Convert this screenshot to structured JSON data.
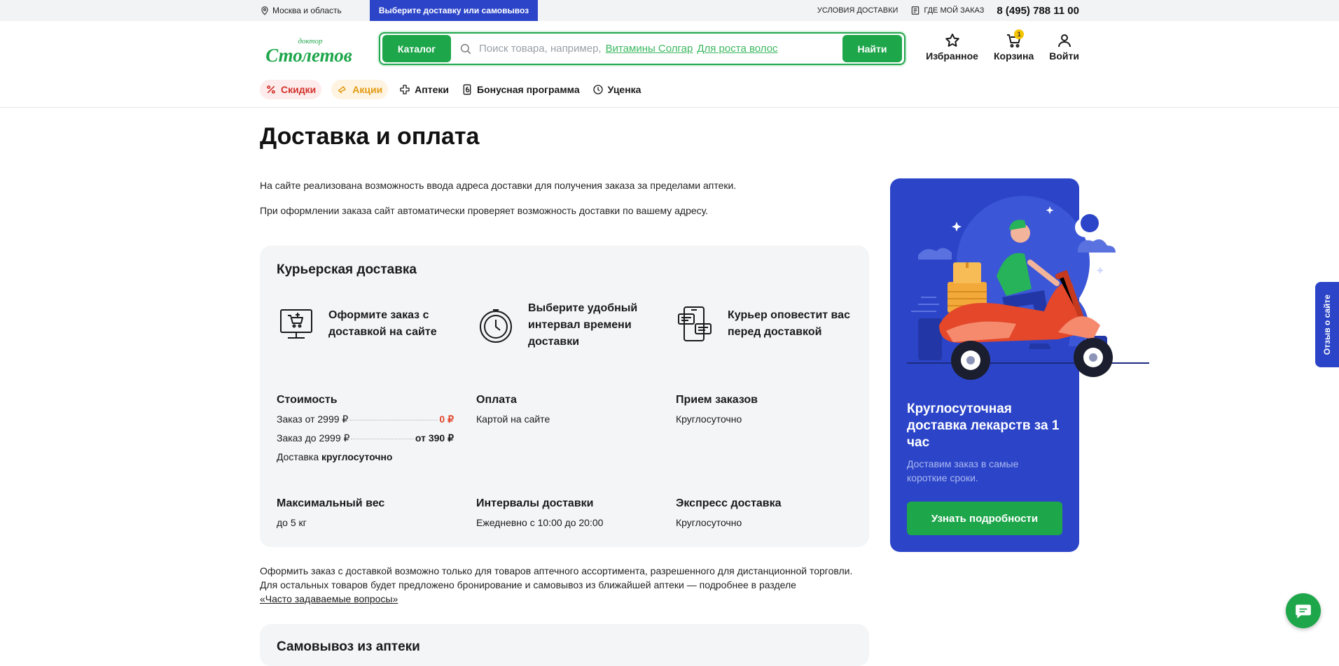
{
  "topbar": {
    "location": "Москва и область",
    "delivery_button": "Выберите доставку или самовывоз",
    "delivery_terms": "условия доставки",
    "where_order": "где мой заказ",
    "phone": "8 (495) 788 11 00"
  },
  "header": {
    "logo_top": "доктор",
    "logo_main": "Столетов",
    "catalog_button": "Каталог",
    "search_placeholder": "Поиск товара, например,",
    "search_example_1": "Витамины Солгар",
    "search_example_2": "Для роста волос",
    "find_button": "Найти",
    "favorites": "Избранное",
    "cart": "Корзина",
    "cart_count": "1",
    "login": "Войти"
  },
  "nav": {
    "sale": "Скидки",
    "promo": "Акции",
    "pharmacies": "Аптеки",
    "bonus": "Бонусная программа",
    "markdown": "Уценка"
  },
  "page": {
    "title": "Доставка и оплата",
    "intro_1": "На сайте реализована возможность ввода адреса доставки для получения заказа за пределами аптеки.",
    "intro_2": "При оформлении заказа сайт автоматически проверяет возможность доставки по вашему адресу."
  },
  "courier": {
    "title": "Курьерская доставка",
    "steps": [
      "Оформите заказ с доставкой на сайте",
      "Выберите удобный интервал времени доставки",
      "Курьер оповестит вас перед доставкой"
    ],
    "cost": {
      "heading": "Стоимость",
      "row1_label": "Заказ от 2999 ₽",
      "row1_value": "0 ₽",
      "row2_label": "Заказ до 2999 ₽",
      "row2_value": "от 390 ₽",
      "row3_label": "Доставка",
      "row3_value": "круглосуточно"
    },
    "payment": {
      "heading": "Оплата",
      "value": "Картой на сайте"
    },
    "orders": {
      "heading": "Прием заказов",
      "value": "Круглосуточно"
    },
    "weight": {
      "heading": "Максимальный вес",
      "value": "до 5 кг"
    },
    "intervals": {
      "heading": "Интервалы доставки",
      "value": "Ежедневно с 10:00 до 20:00"
    },
    "express": {
      "heading": "Экспресс доставка",
      "value": "Круглосуточно"
    }
  },
  "bottom": {
    "text": "Оформить заказ с доставкой возможно только для товаров аптечного ассортимента, разрешенного для дистанционной торговли. Для остальных товаров будет предложено бронирование и самовывоз из ближайшей аптеки — подробнее в разделе",
    "link": "«Часто задаваемые вопросы»",
    "pickup_title": "Самовывоз из аптеки"
  },
  "promo_card": {
    "title": "Круглосуточная доставка лекарств за 1 час",
    "subtitle": "Доставим заказ в самые короткие сроки.",
    "button": "Узнать подробности"
  },
  "feedback": "Отзыв о сайте",
  "colors": {
    "brand_green": "#1ea64b",
    "brand_blue": "#2c45c8",
    "price_red": "#e0452b"
  }
}
